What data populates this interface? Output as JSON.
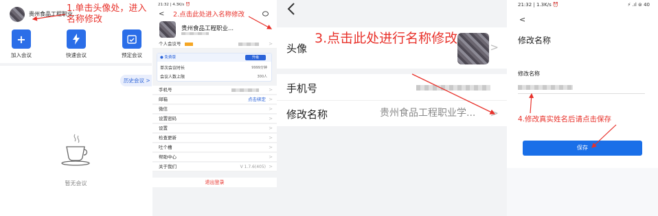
{
  "panel1": {
    "user_name": "贵州食品工程职业...",
    "annotation": "1.单击头像处，进入名称修改",
    "tiles": [
      {
        "label": "加入会议",
        "icon": "plus-icon",
        "color": "#2b6ee8"
      },
      {
        "label": "快速会议",
        "icon": "lightning-icon",
        "color": "#2b6ee8"
      },
      {
        "label": "预定会议",
        "icon": "calendar-check-icon",
        "color": "#2b6ee8"
      }
    ],
    "history_button": "历史会议 >",
    "empty_text": "暂无会议"
  },
  "panel2": {
    "status_bar": "21:32 | 4.3K/s ⏰",
    "annotation": "2.点击此处进入名称修改",
    "user_name": "贵州食品工程职业...",
    "personal_id_label": "个人会议号",
    "vip": {
      "free_label": "● 免费版",
      "upgrade": "升级",
      "rows": [
        {
          "label": "单次会议时长",
          "value": "9999分钟"
        },
        {
          "label": "会议人数上限",
          "value": "300人"
        }
      ]
    },
    "rows": [
      {
        "label": "手机号",
        "value": ""
      },
      {
        "label": "邮箱",
        "value": "点击绑定"
      },
      {
        "label": "微信",
        "value": ""
      },
      {
        "label": "设置密码",
        "value": ""
      },
      {
        "label": "设置",
        "value": ""
      },
      {
        "label": "检查更新",
        "value": ""
      },
      {
        "label": "吐个槽",
        "value": ""
      },
      {
        "label": "帮助中心",
        "value": ""
      },
      {
        "label": "关于我们",
        "value": "V 1.7.6(405)"
      }
    ],
    "logout": "退出登录"
  },
  "panel3": {
    "annotation": "3.点击此处进行名称修改",
    "avatar_label": "头像",
    "phone_label": "手机号",
    "name_label": "修改名称",
    "name_value": "贵州食品工程职业学..."
  },
  "panel4": {
    "status_bar": "21:32 | 1.3K/s ⏰",
    "status_icons": "⚡ .ıl ⊜ 40",
    "title": "修改名称",
    "field_label": "修改名称",
    "annotation": "4.修改真实姓名后请点击保存",
    "save_button": "保存"
  },
  "colors": {
    "annotation": "#e8312a",
    "accent": "#1a6fe8",
    "link": "#2b63d9"
  }
}
